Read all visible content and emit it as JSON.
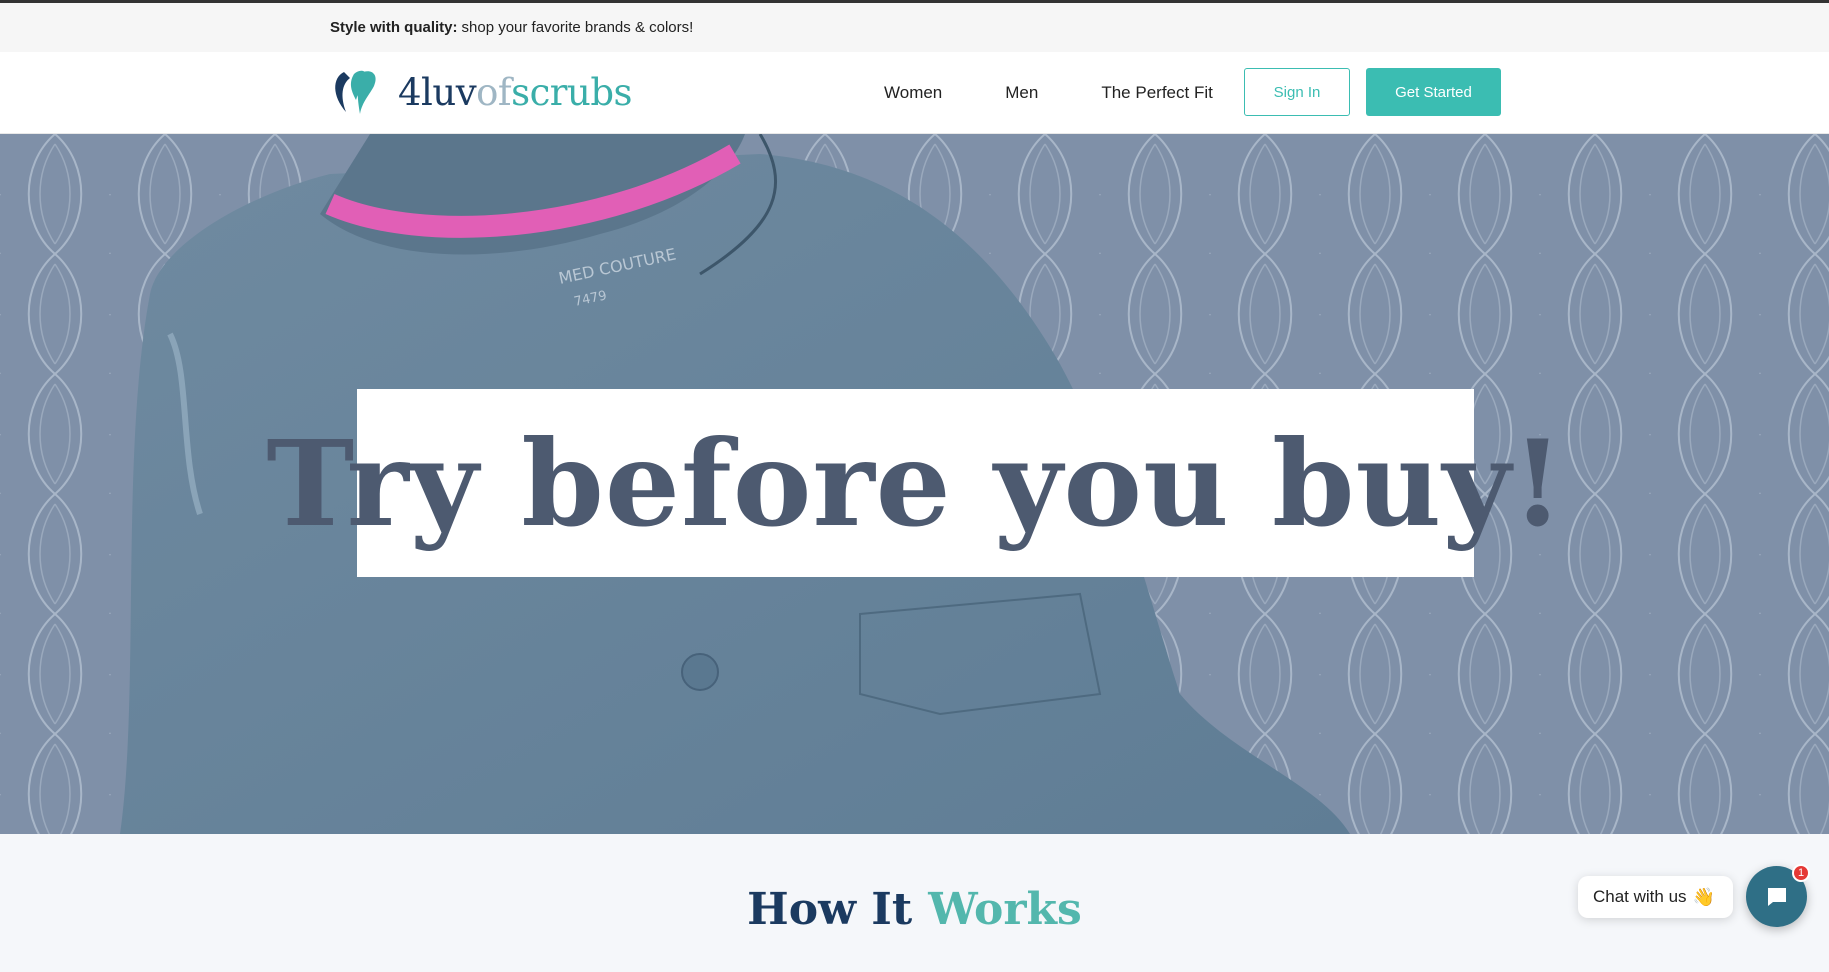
{
  "promo": {
    "bold": "Style with quality:",
    "text": "shop your favorite brands & colors!"
  },
  "logo": {
    "part1": "4luv",
    "part2": "of",
    "part3": "scrubs"
  },
  "nav": {
    "items": [
      {
        "label": "Women"
      },
      {
        "label": "Men"
      },
      {
        "label": "The Perfect Fit"
      }
    ]
  },
  "buttons": {
    "sign_in": "Sign In",
    "get_started": "Get Started"
  },
  "hero": {
    "banner_text": "Try before you buy!",
    "label_brand": "MED COUTURE",
    "label_number": "7479"
  },
  "section": {
    "title_part1": "How It",
    "title_part2": "Works"
  },
  "chat": {
    "label": "Chat with us",
    "wave": "👋",
    "badge": "1",
    "icon": "chat-bubble-icon"
  },
  "colors": {
    "accent": "#3bbdb2",
    "navy": "#1b3a60",
    "hero_blue": "#7b8ba3"
  }
}
